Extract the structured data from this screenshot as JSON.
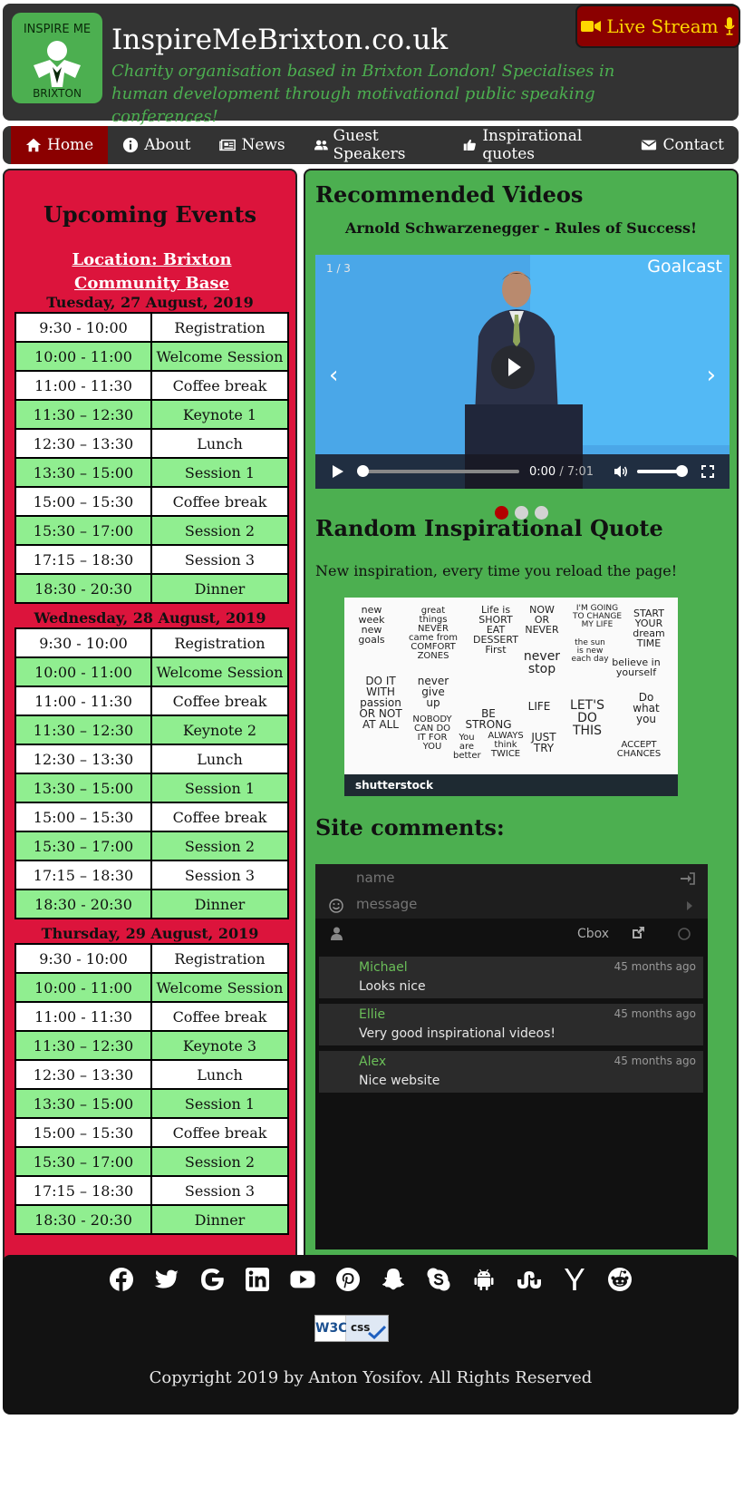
{
  "header": {
    "title": "InspireMeBrixton.co.uk",
    "tagline": "Charity organisation based in Brixton London! Specialises in human development through motivational public speaking conferences!",
    "logo_text_top": "INSPIRE ME",
    "logo_text_bottom": "BRIXTON",
    "live_stream_label": "Live Stream"
  },
  "nav": {
    "items": [
      {
        "label": "Home",
        "icon": "home-icon"
      },
      {
        "label": "About",
        "icon": "info-icon"
      },
      {
        "label": "News",
        "icon": "newspaper-icon"
      },
      {
        "label": "Guest Speakers",
        "icon": "users-icon"
      },
      {
        "label": "Inspirational quotes",
        "icon": "thumbs-up-icon"
      },
      {
        "label": "Contact",
        "icon": "envelope-icon"
      }
    ]
  },
  "events": {
    "title": "Upcoming Events",
    "location": "Location: Brixton Community Base",
    "days": [
      {
        "date": "Tuesday, 27 August, 2019",
        "rows": [
          [
            "9:30 - 10:00",
            "Registration"
          ],
          [
            "10:00 - 11:00",
            "Welcome Session"
          ],
          [
            "11:00 - 11:30",
            "Coffee break"
          ],
          [
            "11:30 – 12:30",
            "Keynote 1"
          ],
          [
            "12:30 – 13:30",
            "Lunch"
          ],
          [
            "13:30 – 15:00",
            "Session 1"
          ],
          [
            "15:00 – 15:30",
            "Coffee break"
          ],
          [
            "15:30 – 17:00",
            "Session 2"
          ],
          [
            "17:15 – 18:30",
            "Session 3"
          ],
          [
            "18:30 - 20:30",
            "Dinner"
          ]
        ]
      },
      {
        "date": "Wednesday, 28 August, 2019",
        "rows": [
          [
            "9:30 - 10:00",
            "Registration"
          ],
          [
            "10:00 - 11:00",
            "Welcome Session"
          ],
          [
            "11:00 - 11:30",
            "Coffee break"
          ],
          [
            "11:30 – 12:30",
            "Keynote 2"
          ],
          [
            "12:30 – 13:30",
            "Lunch"
          ],
          [
            "13:30 – 15:00",
            "Session 1"
          ],
          [
            "15:00 – 15:30",
            "Coffee break"
          ],
          [
            "15:30 – 17:00",
            "Session 2"
          ],
          [
            "17:15 – 18:30",
            "Session 3"
          ],
          [
            "18:30 - 20:30",
            "Dinner"
          ]
        ]
      },
      {
        "date": "Thursday, 29 August, 2019",
        "rows": [
          [
            "9:30 - 10:00",
            "Registration"
          ],
          [
            "10:00 - 11:00",
            "Welcome Session"
          ],
          [
            "11:00 - 11:30",
            "Coffee break"
          ],
          [
            "11:30 – 12:30",
            "Keynote 3"
          ],
          [
            "12:30 – 13:30",
            "Lunch"
          ],
          [
            "13:30 – 15:00",
            "Session 1"
          ],
          [
            "15:00 – 15:30",
            "Coffee break"
          ],
          [
            "15:30 – 17:00",
            "Session 2"
          ],
          [
            "17:15 – 18:30",
            "Session 3"
          ],
          [
            "18:30 - 20:30",
            "Dinner"
          ]
        ]
      }
    ]
  },
  "videos": {
    "heading": "Recommended Videos",
    "title": "Arnold Schwarzenegger - Rules of Success!",
    "counter": "1 / 3",
    "brand": "Goalcast",
    "current_time": "0:00",
    "duration": "/ 7:01",
    "progress": 0,
    "volume": 1,
    "active_slide": 0,
    "slide_count": 3
  },
  "quote": {
    "heading": "Random Inspirational Quote",
    "subtitle": "New inspiration, every time you reload the page!",
    "words": [
      "new week new goals",
      "great things NEVER came from COMFORT ZONES",
      "Life is SHORT EAT DESSERT First",
      "NOW OR NEVER",
      "I'M GOING TO CHANGE MY LIFE",
      "START YOUR dream TIME",
      "the sun is new each day",
      "never stop",
      "believe in yourself",
      "DO IT WITH passion OR NOT AT ALL",
      "never give up",
      "BE STRONG",
      "LIFE",
      "LET'S DO THIS",
      "Do what you",
      "ACCEPT CHANCES",
      "NOBODY CAN DO IT FOR YOU",
      "You are better",
      "ALWAYS think TWICE",
      "JUST TRY"
    ],
    "watermark": "shutterstock"
  },
  "comments": {
    "heading": "Site comments:",
    "name_placeholder": "name",
    "message_placeholder": "message",
    "brand": "Cbox",
    "messages": [
      {
        "name": "Michael",
        "time": "45 months ago",
        "text": "Looks nice"
      },
      {
        "name": "Ellie",
        "time": "45 months ago",
        "text": "Very good inspirational videos!"
      },
      {
        "name": "Alex",
        "time": "45 months ago",
        "text": "Nice website"
      }
    ]
  },
  "footer": {
    "social": [
      "facebook-icon",
      "twitter-icon",
      "google-icon",
      "linkedin-icon",
      "youtube-icon",
      "pinterest-icon",
      "snapchat-icon",
      "skype-icon",
      "android-icon",
      "stumbleupon-icon",
      "hacker-news-icon",
      "reddit-icon"
    ],
    "badge_w3c": "W3C",
    "badge_css": "css",
    "copyright": "Copyright 2019 by Anton Yosifov. All Rights Reserved"
  },
  "colors": {
    "header_bg": "#333333",
    "accent_green": "#4caf50",
    "events_bg": "#dc143c",
    "nav_active": "#8b0000",
    "live_stream_text": "#ffd700",
    "row_even": "#90ee90"
  }
}
